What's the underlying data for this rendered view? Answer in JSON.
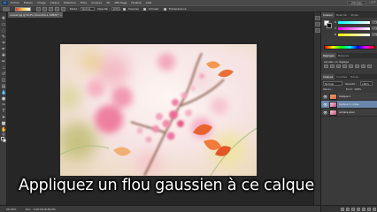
{
  "app": {
    "logo_text": "Ps",
    "menu": [
      "Fichier",
      "Édition",
      "Image",
      "Calque",
      "Sélection",
      "Filtre",
      "Analyse",
      "3D",
      "Affichage",
      "Fenêtre",
      "Aide"
    ],
    "workspace_label": "Principes essentiels",
    "window_controls": [
      "–",
      "□",
      "×"
    ]
  },
  "options_bar": {
    "mode_label": "Mode :",
    "mode_value": "Normal",
    "opacity_label": "Opacité :",
    "opacity_value": "100%",
    "reverse_label": "Inverser",
    "dither_label": "Simuler",
    "transparency_label": "Transparence"
  },
  "document": {
    "tab_title": "cerisier.jpg @ 50,3% (Sans titre-1, RVB/8) *",
    "close": "×"
  },
  "status_bar": {
    "zoom": "50,26%",
    "doc_info": "Doc : 3,00 Mo/6,00 Mo"
  },
  "panels": {
    "color_tabs": [
      "Couleur",
      "Nuancier",
      "Styles"
    ],
    "sliders": [
      {
        "label": "R",
        "value": "255"
      },
      {
        "label": "V",
        "value": "255"
      },
      {
        "label": "B",
        "value": "255"
      }
    ],
    "adjust_tabs": [
      "Réglages",
      "Masques"
    ],
    "adjust_label": "Ajouter un réglage",
    "layers_tabs": [
      "Calques",
      "Couches",
      "Tracés"
    ],
    "blend_mode": "Normal",
    "opacity_label": "Opacité :",
    "opacity_value": "100%",
    "lock_label": "Verrou :",
    "fill_label": "Fond : 100%",
    "layers": [
      {
        "name": "Calque 1",
        "selected": false
      },
      {
        "name": "Calque 1 copie",
        "selected": true
      },
      {
        "name": "Arrière-plan",
        "selected": false
      }
    ]
  },
  "subtitle": "Appliquez un flou gaussien à ce calque"
}
